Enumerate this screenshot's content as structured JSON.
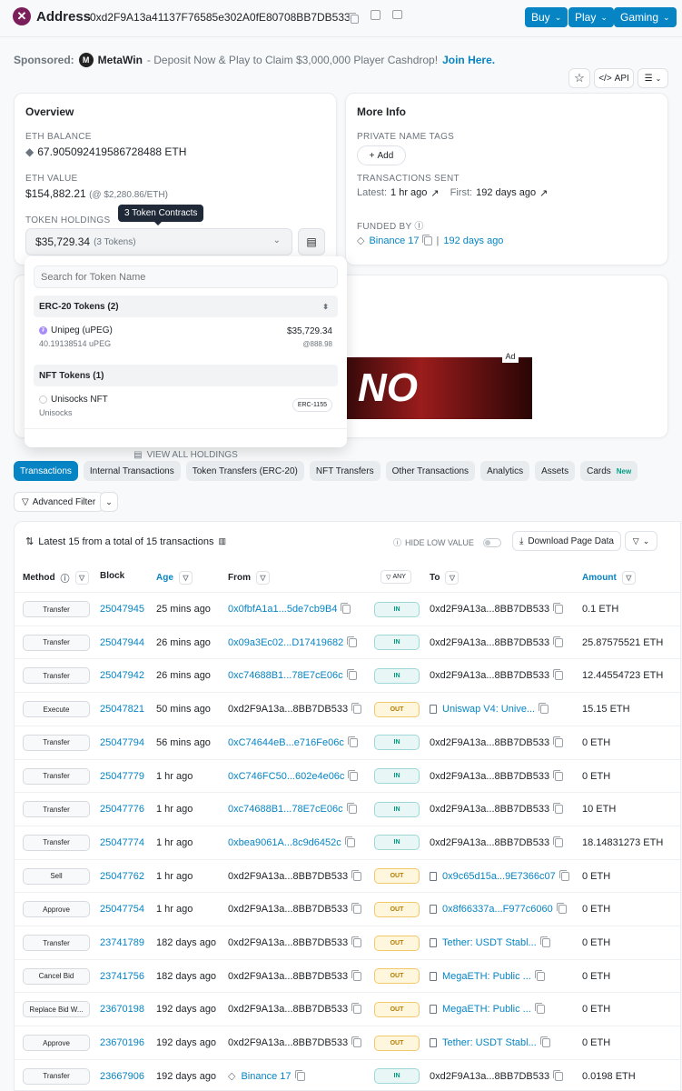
{
  "header": {
    "title": "Address",
    "address": "0xd2F9A13a41137F76585e302A0fE80708BB7DB533",
    "buttons": [
      "Buy",
      "Play",
      "Gaming"
    ]
  },
  "sponsor": {
    "prefix": "Sponsored:",
    "name": "MetaWin",
    "text": "- Deposit Now & Play to Claim $3,000,000 Player Cashdrop!",
    "link": "Join Here."
  },
  "tools": {
    "api": "API"
  },
  "overview": {
    "title": "Overview",
    "eth_balance_label": "ETH BALANCE",
    "eth_balance": "67.905092419586728488 ETH",
    "eth_value_label": "ETH VALUE",
    "eth_value": "$154,882.21",
    "eth_price": "(@ $2,280.86/ETH)",
    "token_holdings_label": "TOKEN HOLDINGS",
    "token_tooltip": "3 Token Contracts",
    "token_value": "$35,729.34",
    "token_count": "(3 Tokens)"
  },
  "more_info": {
    "title": "More Info",
    "private_tags_label": "PRIVATE NAME TAGS",
    "add_label": "Add",
    "tx_sent_label": "TRANSACTIONS SENT",
    "latest_prefix": "Latest:",
    "latest_value": "1 hr ago",
    "first_prefix": "First:",
    "first_value": "192 days ago",
    "funded_by_label": "FUNDED BY",
    "funded_by": "Binance 17",
    "funded_age": "192 days ago"
  },
  "dropdown": {
    "search_placeholder": "Search for Token Name",
    "erc20_header": "ERC-20 Tokens (2)",
    "erc20_token_name": "Unipeg (uPEG)",
    "erc20_token_amount": "40.19138514 uPEG",
    "erc20_token_value": "$35,729.34",
    "erc20_token_price": "@888.98",
    "nft_header": "NFT Tokens (1)",
    "nft_name": "Unisocks NFT",
    "nft_sub": "Unisocks",
    "nft_std": "ERC-1155",
    "view_all": "VIEW ALL HOLDINGS"
  },
  "ad": {
    "label": "Ad",
    "text": "NO"
  },
  "tabs": [
    "Transactions",
    "Internal Transactions",
    "Token Transfers (ERC-20)",
    "NFT Transfers",
    "Other Transactions",
    "Analytics",
    "Assets",
    "Cards"
  ],
  "tabs_new_badge": "New",
  "advanced_filter": "Advanced Filter",
  "table": {
    "summary": "Latest 15 from a total of 15 transactions",
    "hide_low_value": "HIDE LOW VALUE",
    "download": "Download Page Data",
    "headers": {
      "method": "Method",
      "block": "Block",
      "age": "Age",
      "from": "From",
      "any": "ANY",
      "to": "To",
      "amount": "Amount"
    },
    "rows": [
      {
        "method": "Transfer",
        "block": "25047945",
        "age": "25 mins ago",
        "from": "0x0fbfA1a1...5de7cb9B4",
        "dir": "IN",
        "to": "0xd2F9A13a...8BB7DB533",
        "amount": "0.1 ETH"
      },
      {
        "method": "Transfer",
        "block": "25047944",
        "age": "26 mins ago",
        "from": "0x09a3Ec02...D17419682",
        "dir": "IN",
        "to": "0xd2F9A13a...8BB7DB533",
        "amount": "25.87575521 ETH"
      },
      {
        "method": "Transfer",
        "block": "25047942",
        "age": "26 mins ago",
        "from": "0xc74688B1...78E7cE06c",
        "dir": "IN",
        "to": "0xd2F9A13a...8BB7DB533",
        "amount": "12.44554723 ETH"
      },
      {
        "method": "Execute",
        "block": "25047821",
        "age": "50 mins ago",
        "from": "0xd2F9A13a...8BB7DB533",
        "dir": "OUT",
        "to": "Uniswap V4: Unive...",
        "amount": "15.15 ETH"
      },
      {
        "method": "Transfer",
        "block": "25047794",
        "age": "56 mins ago",
        "from": "0xC74644eB...e716Fe06c",
        "dir": "IN",
        "to": "0xd2F9A13a...8BB7DB533",
        "amount": "0 ETH"
      },
      {
        "method": "Transfer",
        "block": "25047779",
        "age": "1 hr ago",
        "from": "0xC746FC50...602e4e06c",
        "dir": "IN",
        "to": "0xd2F9A13a...8BB7DB533",
        "amount": "0 ETH"
      },
      {
        "method": "Transfer",
        "block": "25047776",
        "age": "1 hr ago",
        "from": "0xc74688B1...78E7cE06c",
        "dir": "IN",
        "to": "0xd2F9A13a...8BB7DB533",
        "amount": "10 ETH"
      },
      {
        "method": "Transfer",
        "block": "25047774",
        "age": "1 hr ago",
        "from": "0xbea9061A...8c9d6452c",
        "dir": "IN",
        "to": "0xd2F9A13a...8BB7DB533",
        "amount": "18.14831273 ETH"
      },
      {
        "method": "Sell",
        "block": "25047762",
        "age": "1 hr ago",
        "from": "0xd2F9A13a...8BB7DB533",
        "dir": "OUT",
        "to": "0x9c65d15a...9E7366c07",
        "amount": "0 ETH"
      },
      {
        "method": "Approve",
        "block": "25047754",
        "age": "1 hr ago",
        "from": "0xd2F9A13a...8BB7DB533",
        "dir": "OUT",
        "to": "0x8f66337a...F977c6060",
        "amount": "0 ETH"
      },
      {
        "method": "Transfer",
        "block": "23741789",
        "age": "182 days ago",
        "from": "0xd2F9A13a...8BB7DB533",
        "dir": "OUT",
        "to": "Tether: USDT Stabl...",
        "amount": "0 ETH"
      },
      {
        "method": "Cancel Bid",
        "block": "23741756",
        "age": "182 days ago",
        "from": "0xd2F9A13a...8BB7DB533",
        "dir": "OUT",
        "to": "MegaETH: Public ...",
        "amount": "0 ETH"
      },
      {
        "method": "Replace Bid W...",
        "block": "23670198",
        "age": "192 days ago",
        "from": "0xd2F9A13a...8BB7DB533",
        "dir": "OUT",
        "to": "MegaETH: Public ...",
        "amount": "0 ETH"
      },
      {
        "method": "Approve",
        "block": "23670196",
        "age": "192 days ago",
        "from": "0xd2F9A13a...8BB7DB533",
        "dir": "OUT",
        "to": "Tether: USDT Stabl...",
        "amount": "0 ETH"
      },
      {
        "method": "Transfer",
        "block": "23667906",
        "age": "192 days ago",
        "from": "Binance 17",
        "dir": "IN",
        "to": "0xd2F9A13a...8BB7DB533",
        "amount": "0.0198 ETH"
      }
    ]
  }
}
